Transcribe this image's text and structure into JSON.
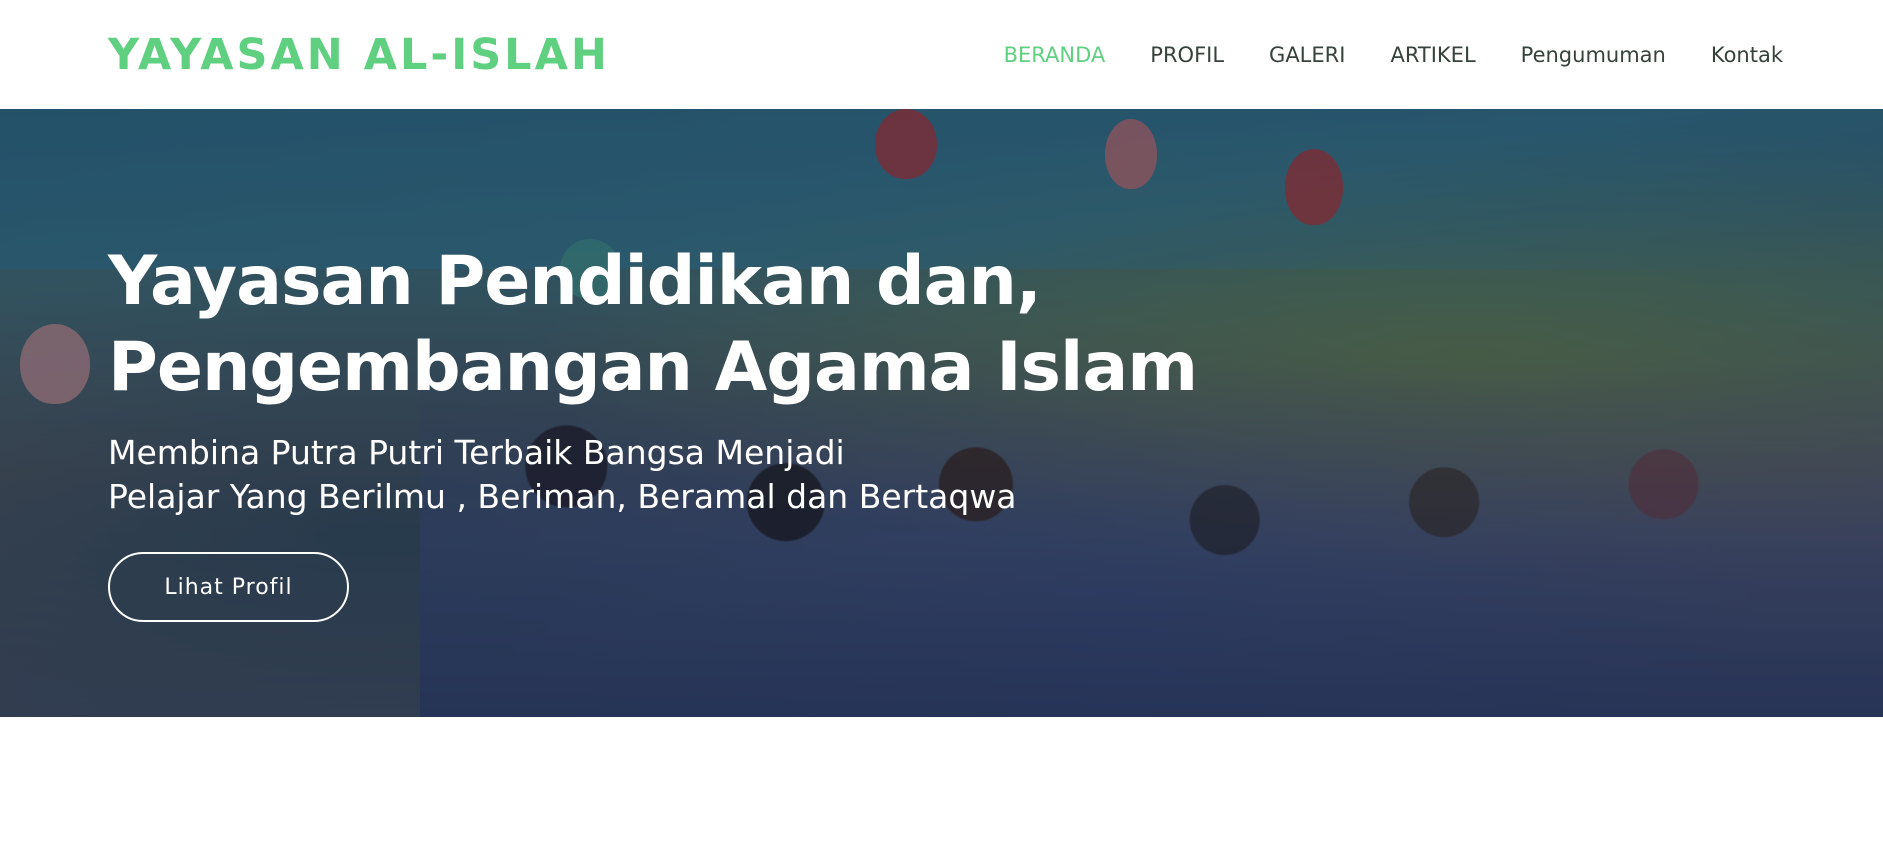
{
  "brand": {
    "name": "YAYASAN AL-ISLAH"
  },
  "nav": {
    "items": [
      {
        "label": "BERANDA",
        "active": true
      },
      {
        "label": "PROFIL",
        "active": false
      },
      {
        "label": "GALERI",
        "active": false
      },
      {
        "label": "ARTIKEL",
        "active": false
      },
      {
        "label": "Pengumuman",
        "active": false
      },
      {
        "label": "Kontak",
        "active": false
      }
    ]
  },
  "hero": {
    "title_line1": "Yayasan Pendidikan dan,",
    "title_line2": "Pengembangan Agama Islam",
    "subtitle_line1": "Membina Putra Putri Terbaik Bangsa Menjadi",
    "subtitle_line2": "Pelajar Yang Berilmu , Beriman, Beramal dan Bertaqwa",
    "button_label": "Lihat Profil"
  },
  "colors": {
    "accent": "#5fcf80",
    "nav_text": "#37423b",
    "hero_text": "#ffffff"
  }
}
